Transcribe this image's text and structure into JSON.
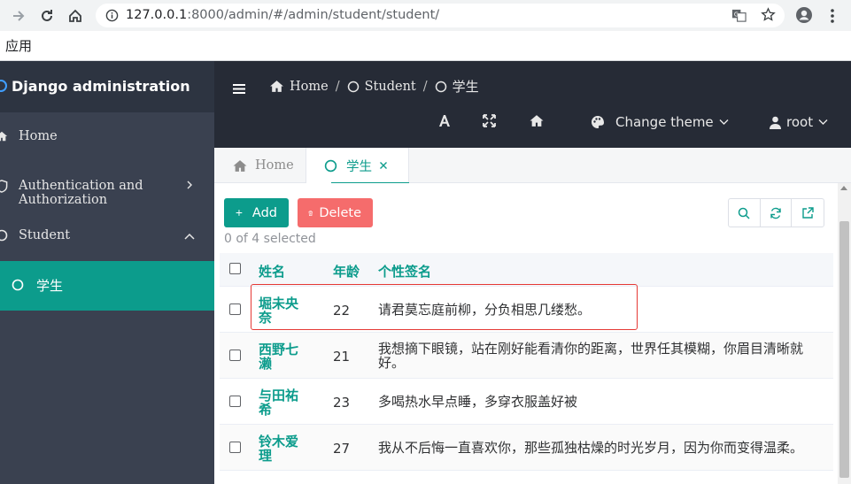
{
  "browser": {
    "url_host": "127.0.0.1",
    "url_rest": ":8000/admin/#/admin/student/student/",
    "bookmark": "应用"
  },
  "sidebar": {
    "brand": "Django administration",
    "items": [
      {
        "label": "Home",
        "icon": "home-icon"
      },
      {
        "label": "Authentication and Authorization",
        "icon": "shield-icon"
      },
      {
        "label": "Student",
        "icon": "circle-icon"
      },
      {
        "label": "学生",
        "icon": "circle-icon"
      }
    ]
  },
  "header": {
    "breadcrumb": {
      "home": "Home",
      "sep": "/",
      "student": "Student",
      "current": "学生"
    },
    "change_theme": "Change theme",
    "user": "root"
  },
  "tabs": {
    "home": "Home",
    "current": "学生"
  },
  "toolbar": {
    "add": "Add",
    "delete": "Delete",
    "selected": "0 of 4 selected"
  },
  "table": {
    "headers": {
      "name": "姓名",
      "age": "年龄",
      "signature": "个性签名"
    },
    "rows": [
      {
        "name": "堀未央奈",
        "age": "22",
        "signature": "请君莫忘庭前柳，分负相思几缕愁。"
      },
      {
        "name": "西野七濑",
        "age": "21",
        "signature": "我想摘下眼镜，站在刚好能看清你的距离，世界任其模糊，你眉目清晰就好。"
      },
      {
        "name": "与田祐希",
        "age": "23",
        "signature": "多喝热水早点睡，多穿衣服盖好被"
      },
      {
        "name": "铃木爱理",
        "age": "27",
        "signature": "我从不后悔一直喜欢你，那些孤独枯燥的时光岁月，因为你而变得温柔。"
      }
    ]
  },
  "colors": {
    "accent": "#0c9c8c",
    "danger": "#f56c6c",
    "sidebar": "#3a4150",
    "header": "#262b36"
  }
}
